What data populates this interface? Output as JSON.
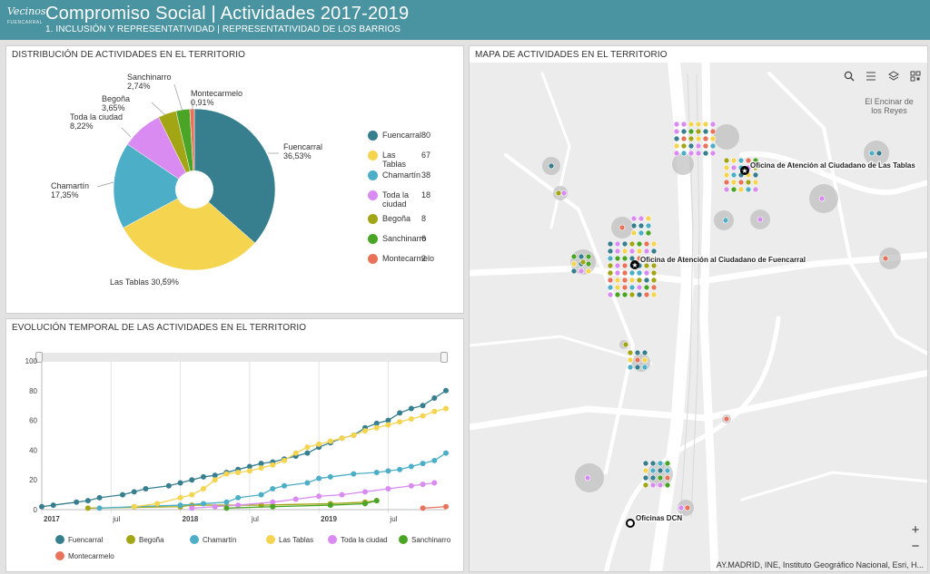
{
  "header": {
    "logo_text": "Vecinos",
    "logo_subtext": "FUENCARRAL",
    "title": "Compromiso Social | Actividades 2017-2019",
    "subtitle": "1. INCLUSIÓN Y REPRESENTATIVIDAD | REPRESENTATIVIDAD DE LOS BARRIOS"
  },
  "pie_panel": {
    "title": "DISTRIBUCIÓN DE ACTIVIDADES EN EL TERRITORIO"
  },
  "line_panel": {
    "title": "EVOLUCIÓN TEMPORAL DE LAS ACTIVIDADES EN EL TERRITORIO"
  },
  "map_panel": {
    "title": "MAPA DE ACTIVIDADES EN EL TERRITORIO",
    "tools": [
      "search-icon",
      "list-icon",
      "layers-icon",
      "qr-icon"
    ],
    "place_labels": [
      "El Encinar de los Reyes"
    ],
    "offices": [
      {
        "label": "Oficina de Atención al Ciudadano de Las Tablas"
      },
      {
        "label": "Oficina de Atención al Ciudadano de Fuencarral"
      },
      {
        "label": "Oficinas DCN"
      }
    ],
    "zoom_in": "+",
    "zoom_out": "−",
    "attribution": "AY.MADRID, INE, Instituto Geográfico Nacional, Esri, H..."
  },
  "colors": {
    "header": "#4a93a1",
    "Fuencarral": "#377f8e",
    "Las Tablas": "#f5d44f",
    "Chamartín": "#4daec7",
    "Toda la ciudad": "#d98bf1",
    "Begoña": "#a2a514",
    "Sanchinarro": "#4aa526",
    "Montecarmelo": "#e8735a"
  },
  "chart_data": [
    {
      "type": "pie",
      "slices": [
        {
          "name": "Fuencarral",
          "value": 80,
          "pct": "36,53%"
        },
        {
          "name": "Las Tablas",
          "value": 67,
          "pct": "30,59%"
        },
        {
          "name": "Chamartín",
          "value": 38,
          "pct": "17,35%"
        },
        {
          "name": "Toda la ciudad",
          "value": 18,
          "pct": "8,22%"
        },
        {
          "name": "Begoña",
          "value": 8,
          "pct": "3,65%"
        },
        {
          "name": "Sanchinarro",
          "value": 6,
          "pct": "2,74%"
        },
        {
          "name": "Montecarmelo",
          "value": 2,
          "pct": "0,91%"
        }
      ],
      "legend": [
        {
          "label": "Fuencarral",
          "value": "80"
        },
        {
          "label": "Las Tablas",
          "value": "67"
        },
        {
          "label": "Chamartín",
          "value": "38"
        },
        {
          "label": "Toda la ciudad",
          "value": "18"
        },
        {
          "label": "Begoña",
          "value": "8"
        },
        {
          "label": "Sanchinarro",
          "value": "6"
        },
        {
          "label": "Montecarmelo",
          "value": "2"
        }
      ],
      "legend_placement": "right",
      "donut_hole": true
    },
    {
      "type": "line",
      "x_tick_labels": [
        "2017",
        "jul",
        "2018",
        "jul",
        "2019",
        "jul"
      ],
      "y_ticks": [
        0,
        20,
        40,
        60,
        80,
        100
      ],
      "ylim": [
        0,
        100
      ],
      "xlim": [
        "2017-01",
        "2019-12"
      ],
      "grid": "vertical",
      "legend_placement": "bottom",
      "series": [
        {
          "name": "Fuencarral",
          "points": [
            [
              "2017-01",
              2
            ],
            [
              "2017-02",
              3
            ],
            [
              "2017-04",
              5
            ],
            [
              "2017-05",
              6
            ],
            [
              "2017-06",
              8
            ],
            [
              "2017-08",
              10
            ],
            [
              "2017-09",
              12
            ],
            [
              "2017-10",
              14
            ],
            [
              "2017-12",
              16
            ],
            [
              "2018-01",
              18
            ],
            [
              "2018-02",
              20
            ],
            [
              "2018-03",
              22
            ],
            [
              "2018-04",
              23
            ],
            [
              "2018-05",
              25
            ],
            [
              "2018-06",
              27
            ],
            [
              "2018-07",
              29
            ],
            [
              "2018-08",
              31
            ],
            [
              "2018-09",
              32
            ],
            [
              "2018-10",
              34
            ],
            [
              "2018-11",
              36
            ],
            [
              "2018-12",
              38
            ],
            [
              "2019-01",
              42
            ],
            [
              "2019-02",
              45
            ],
            [
              "2019-03",
              48
            ],
            [
              "2019-04",
              50
            ],
            [
              "2019-05",
              55
            ],
            [
              "2019-06",
              58
            ],
            [
              "2019-07",
              60
            ],
            [
              "2019-08",
              65
            ],
            [
              "2019-09",
              68
            ],
            [
              "2019-10",
              70
            ],
            [
              "2019-11",
              75
            ],
            [
              "2019-12",
              80
            ]
          ]
        },
        {
          "name": "Begoña",
          "points": [
            [
              "2017-05",
              1
            ],
            [
              "2018-01",
              2
            ],
            [
              "2018-02",
              3
            ],
            [
              "2018-08",
              3
            ],
            [
              "2019-02",
              4
            ],
            [
              "2019-05",
              5
            ],
            [
              "2019-06",
              6
            ]
          ]
        },
        {
          "name": "Chamartín",
          "points": [
            [
              "2017-06",
              1
            ],
            [
              "2017-09",
              2
            ],
            [
              "2018-01",
              3
            ],
            [
              "2018-03",
              4
            ],
            [
              "2018-05",
              5
            ],
            [
              "2018-06",
              8
            ],
            [
              "2018-08",
              10
            ],
            [
              "2018-09",
              14
            ],
            [
              "2018-10",
              16
            ],
            [
              "2018-12",
              18
            ],
            [
              "2019-01",
              21
            ],
            [
              "2019-02",
              22
            ],
            [
              "2019-04",
              24
            ],
            [
              "2019-06",
              25
            ],
            [
              "2019-07",
              26
            ],
            [
              "2019-08",
              27
            ],
            [
              "2019-09",
              29
            ],
            [
              "2019-10",
              31
            ],
            [
              "2019-11",
              33
            ],
            [
              "2019-12",
              38
            ]
          ]
        },
        {
          "name": "Las Tablas",
          "points": [
            [
              "2017-09",
              2
            ],
            [
              "2017-11",
              4
            ],
            [
              "2018-01",
              8
            ],
            [
              "2018-02",
              10
            ],
            [
              "2018-03",
              14
            ],
            [
              "2018-04",
              20
            ],
            [
              "2018-05",
              24
            ],
            [
              "2018-06",
              25
            ],
            [
              "2018-07",
              26
            ],
            [
              "2018-08",
              28
            ],
            [
              "2018-09",
              30
            ],
            [
              "2018-10",
              33
            ],
            [
              "2018-11",
              38
            ],
            [
              "2018-12",
              42
            ],
            [
              "2019-01",
              44
            ],
            [
              "2019-02",
              46
            ],
            [
              "2019-03",
              48
            ],
            [
              "2019-04",
              50
            ],
            [
              "2019-05",
              53
            ],
            [
              "2019-06",
              55
            ],
            [
              "2019-07",
              57
            ],
            [
              "2019-08",
              59
            ],
            [
              "2019-09",
              61
            ],
            [
              "2019-10",
              63
            ],
            [
              "2019-11",
              66
            ],
            [
              "2019-12",
              68
            ]
          ]
        },
        {
          "name": "Toda la ciudad",
          "points": [
            [
              "2018-02",
              1
            ],
            [
              "2018-04",
              2
            ],
            [
              "2018-06",
              3
            ],
            [
              "2018-09",
              5
            ],
            [
              "2018-11",
              7
            ],
            [
              "2019-01",
              9
            ],
            [
              "2019-03",
              10
            ],
            [
              "2019-05",
              12
            ],
            [
              "2019-07",
              14
            ],
            [
              "2019-09",
              16
            ],
            [
              "2019-10",
              17
            ],
            [
              "2019-11",
              18
            ]
          ]
        },
        {
          "name": "Sanchinarro",
          "points": [
            [
              "2018-05",
              1
            ],
            [
              "2018-09",
              2
            ],
            [
              "2019-02",
              3
            ],
            [
              "2019-05",
              4
            ],
            [
              "2019-06",
              6
            ]
          ]
        },
        {
          "name": "Montecarmelo",
          "points": [
            [
              "2019-10",
              1
            ],
            [
              "2019-12",
              2
            ]
          ]
        }
      ]
    }
  ]
}
